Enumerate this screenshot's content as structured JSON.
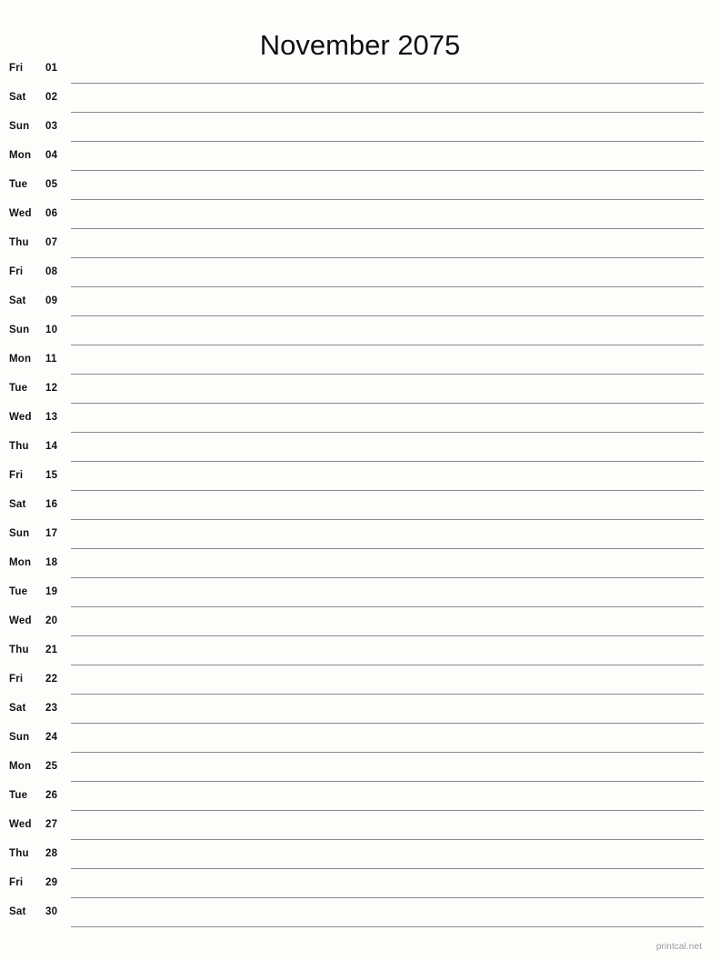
{
  "header": {
    "title": "November 2075",
    "month": "November",
    "year": "2075"
  },
  "calendar": {
    "type": "single-month-list",
    "day_count": 30,
    "rows": [
      {
        "weekday": "Fri",
        "day": "01"
      },
      {
        "weekday": "Sat",
        "day": "02"
      },
      {
        "weekday": "Sun",
        "day": "03"
      },
      {
        "weekday": "Mon",
        "day": "04"
      },
      {
        "weekday": "Tue",
        "day": "05"
      },
      {
        "weekday": "Wed",
        "day": "06"
      },
      {
        "weekday": "Thu",
        "day": "07"
      },
      {
        "weekday": "Fri",
        "day": "08"
      },
      {
        "weekday": "Sat",
        "day": "09"
      },
      {
        "weekday": "Sun",
        "day": "10"
      },
      {
        "weekday": "Mon",
        "day": "11"
      },
      {
        "weekday": "Tue",
        "day": "12"
      },
      {
        "weekday": "Wed",
        "day": "13"
      },
      {
        "weekday": "Thu",
        "day": "14"
      },
      {
        "weekday": "Fri",
        "day": "15"
      },
      {
        "weekday": "Sat",
        "day": "16"
      },
      {
        "weekday": "Sun",
        "day": "17"
      },
      {
        "weekday": "Mon",
        "day": "18"
      },
      {
        "weekday": "Tue",
        "day": "19"
      },
      {
        "weekday": "Wed",
        "day": "20"
      },
      {
        "weekday": "Thu",
        "day": "21"
      },
      {
        "weekday": "Fri",
        "day": "22"
      },
      {
        "weekday": "Sat",
        "day": "23"
      },
      {
        "weekday": "Sun",
        "day": "24"
      },
      {
        "weekday": "Mon",
        "day": "25"
      },
      {
        "weekday": "Tue",
        "day": "26"
      },
      {
        "weekday": "Wed",
        "day": "27"
      },
      {
        "weekday": "Thu",
        "day": "28"
      },
      {
        "weekday": "Fri",
        "day": "29"
      },
      {
        "weekday": "Sat",
        "day": "30"
      }
    ]
  },
  "footer": {
    "credit": "printcal.net"
  },
  "colors": {
    "background": "#fdfdfb",
    "text": "#111111",
    "rule": "#8a8a8a",
    "footer_text": "#9a9a9a"
  }
}
